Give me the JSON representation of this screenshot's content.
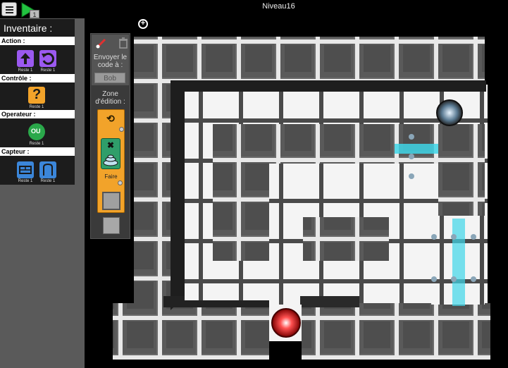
{
  "level": {
    "title": "Niveau16"
  },
  "toolbar": {
    "speed": "1"
  },
  "inventory": {
    "title": "Inventaire :",
    "sections": [
      {
        "label": "Action :",
        "blocks": [
          {
            "name": "move-forward-block",
            "icon": "arrow-up-icon",
            "color": "#9b59f0",
            "remaining": "Reste 1"
          },
          {
            "name": "turn-left-block",
            "icon": "rotate-left-icon",
            "color": "#9b59f0",
            "remaining": "Reste 1"
          }
        ]
      },
      {
        "label": "Contrôle :",
        "blocks": [
          {
            "name": "if-block",
            "icon": "question-icon",
            "color": "#f2a32a",
            "remaining": "Reste 1"
          }
        ]
      },
      {
        "label": "Operateur :",
        "blocks": [
          {
            "name": "or-block",
            "icon": "or-icon",
            "color": "#2aa84a",
            "text": "OU",
            "remaining": "Reste 1"
          }
        ]
      },
      {
        "label": "Capteur :",
        "blocks": [
          {
            "name": "wall-sensor-block",
            "icon": "wall-icon",
            "color": "#3b86d9",
            "remaining": "Reste 1"
          },
          {
            "name": "door-sensor-block",
            "icon": "door-icon",
            "color": "#3b86d9",
            "remaining": "Reste 1"
          }
        ]
      }
    ]
  },
  "edit_panel": {
    "send_label": "Envoyer le code à :",
    "agent_name": "Bob",
    "zone_label": "Zone d'édition :",
    "faire_label": "Faire",
    "cond_icon": "exit-icon"
  },
  "colors": {
    "loop": "#f2a32a",
    "action": "#9b59f0",
    "sensor": "#3b86d9",
    "operator": "#2aa84a",
    "door": "#3fd6e8",
    "exit": "#e02020"
  }
}
